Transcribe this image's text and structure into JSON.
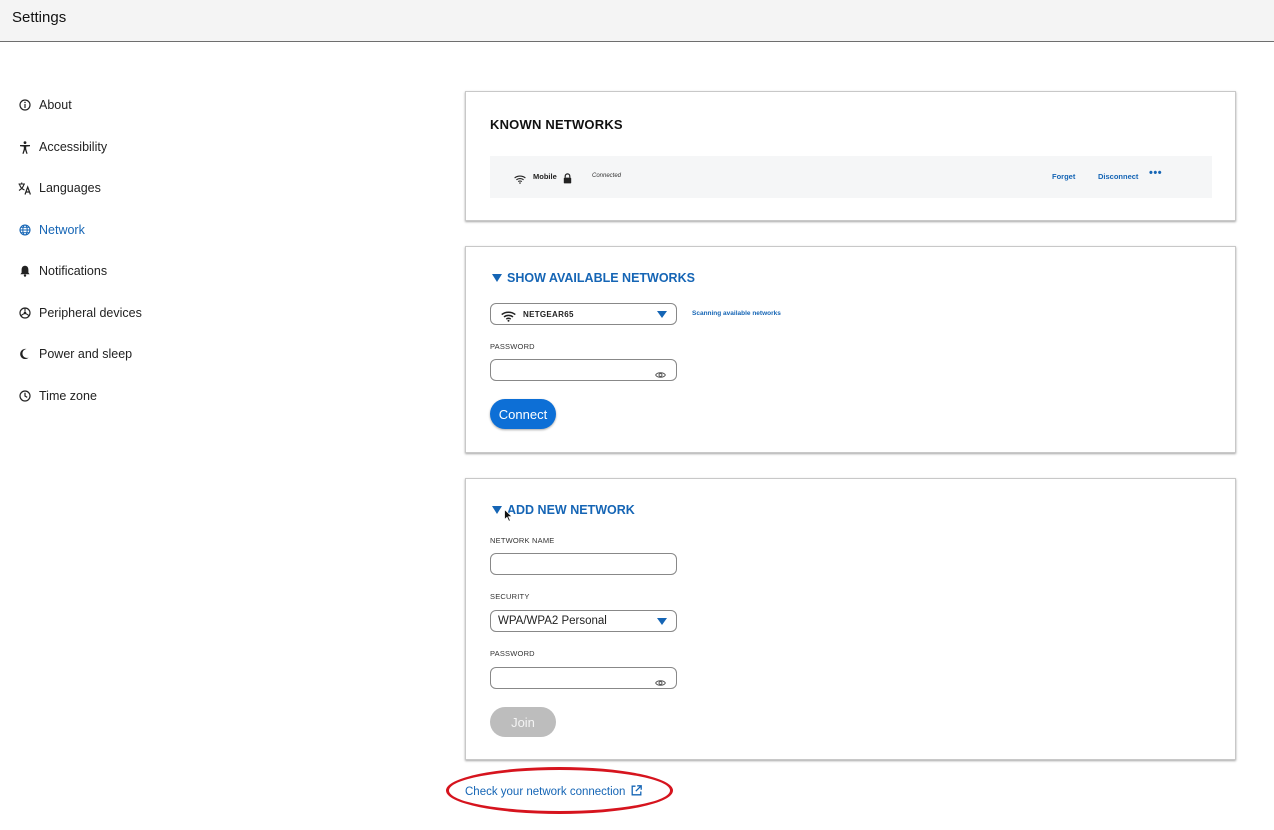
{
  "window": {
    "title": "Settings"
  },
  "sidebar": {
    "items": [
      {
        "label": "About",
        "icon": "info-icon"
      },
      {
        "label": "Accessibility",
        "icon": "accessibility-icon"
      },
      {
        "label": "Languages",
        "icon": "translate-icon"
      },
      {
        "label": "Network",
        "icon": "globe-icon",
        "active": true
      },
      {
        "label": "Notifications",
        "icon": "bell-icon"
      },
      {
        "label": "Peripheral devices",
        "icon": "peripheral-icon"
      },
      {
        "label": "Power and sleep",
        "icon": "moon-icon"
      },
      {
        "label": "Time zone",
        "icon": "clock-icon"
      }
    ]
  },
  "known_networks": {
    "title": "KNOWN NETWORKS",
    "network": {
      "name": "Mobile",
      "status": "Connected",
      "forget_label": "Forget",
      "disconnect_label": "Disconnect",
      "more_label": "•••"
    }
  },
  "available_networks": {
    "heading": "SHOW AVAILABLE NETWORKS",
    "selected_network": "NETGEAR65",
    "scanning_text": "Scanning available networks",
    "password_label": "PASSWORD",
    "password_value": "",
    "connect_label": "Connect"
  },
  "add_network": {
    "heading": "ADD NEW NETWORK",
    "name_label": "NETWORK NAME",
    "name_value": "",
    "security_label": "SECURITY",
    "security_value": "WPA/WPA2 Personal",
    "password_label": "PASSWORD",
    "password_value": "",
    "join_label": "Join"
  },
  "footer": {
    "check_link": "Check your network connection"
  },
  "colors": {
    "accent": "#1565b5",
    "primary_button": "#0d6fd6",
    "highlight": "#d6141e"
  }
}
